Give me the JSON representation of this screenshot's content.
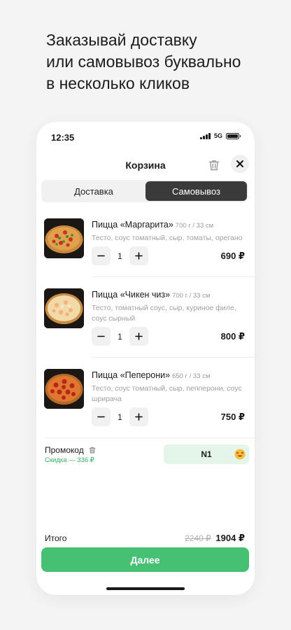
{
  "headline": {
    "line1": "Заказывай доставку",
    "line2": "или самовывоз буквально",
    "line3": "в несколько кликов"
  },
  "status": {
    "time": "12:35",
    "network": "5G"
  },
  "header": {
    "title": "Корзина"
  },
  "tabs": {
    "delivery": "Доставка",
    "pickup": "Самовывоз",
    "selected": "pickup"
  },
  "items": [
    {
      "name": "Пицца «Маргарита»",
      "weight": "700 г / 33 см",
      "desc": "Тесто, соус томатный, сыр, томаты, орегано",
      "qty": "1",
      "price": "690 ₽"
    },
    {
      "name": "Пицца «Чикен чиз»",
      "weight": "700 г / 33 см",
      "desc": "Тесто, томатный соус, сыр, куриное филе, соус сырный",
      "qty": "1",
      "price": "800 ₽"
    },
    {
      "name": "Пицца «Пеперони»",
      "weight": "650 г / 33 см",
      "desc": "Тесто, соус томатный, сыр, пепперони, соус шрирача",
      "qty": "1",
      "price": "750 ₽"
    }
  ],
  "promo": {
    "label": "Промокод",
    "discount": "Скидка — 336 ₽",
    "code": "N1"
  },
  "total": {
    "label": "Итого",
    "old": "2240 ₽",
    "new": "1904 ₽"
  },
  "next_button": "Далее",
  "colors": {
    "accent": "#46c173",
    "discount": "#2fb35c",
    "promo_bg": "#e4f6e9",
    "tab_active": "#3a3a3a"
  }
}
